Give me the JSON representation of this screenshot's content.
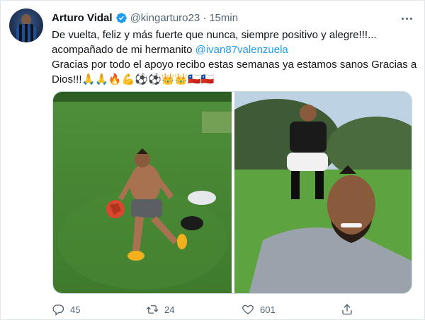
{
  "tweet": {
    "author_name": "Arturo Vidal",
    "handle": "@kingarturo23",
    "separator": "·",
    "time": "15min",
    "text_lines": [
      "De vuelta, feliz y más fuerte que nunca, siempre positivo y alegre!!!...",
      "acompañado de mi hermanito ",
      "Gracias por todo el apoyo recibo estas semanas ya estamos sanos Gracias a",
      "Dios!!!"
    ],
    "mention": "@ivan87valenzuela",
    "emojis": [
      "🙏",
      "🙏",
      "🔥",
      "💪",
      "⚽",
      "⚽",
      "👑",
      "👑",
      "🇨🇱",
      "🇨🇱"
    ],
    "media": [
      {
        "icon": "photo-man-sitting-on-grass-with-ball"
      },
      {
        "icon": "photo-selfie-with-brother-on-field"
      }
    ]
  },
  "actions": {
    "replies": "45",
    "retweets": "24",
    "likes": "601",
    "share_icon": "share-icon"
  },
  "colors": {
    "text": "#0f1419",
    "muted": "#536471",
    "link": "#1d9bf0",
    "verified": "#1d9bf0"
  }
}
